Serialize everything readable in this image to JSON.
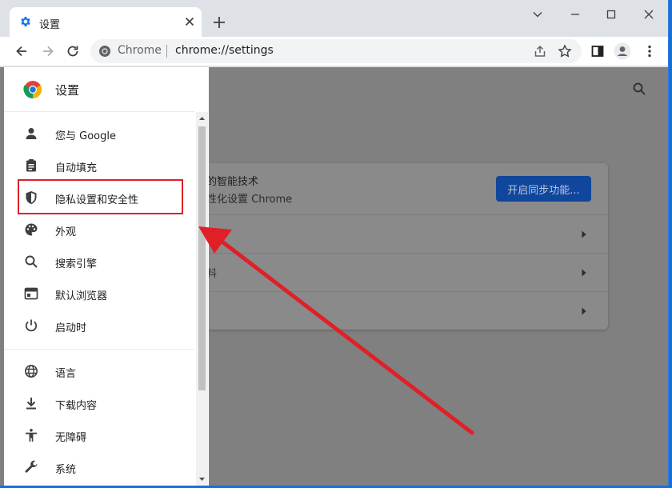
{
  "tab": {
    "title": "设置"
  },
  "omnibox": {
    "site_label": "Chrome",
    "url": "chrome://settings"
  },
  "sidebar": {
    "title": "设置",
    "items": [
      {
        "label": "您与 Google",
        "icon": "person-icon"
      },
      {
        "label": "自动填充",
        "icon": "clipboard-icon"
      },
      {
        "label": "隐私设置和安全性",
        "icon": "shield-icon"
      },
      {
        "label": "外观",
        "icon": "palette-icon"
      },
      {
        "label": "搜索引擎",
        "icon": "search-icon"
      },
      {
        "label": "默认浏览器",
        "icon": "browser-window-icon"
      },
      {
        "label": "启动时",
        "icon": "power-icon"
      },
      {
        "label": "语言",
        "icon": "globe-icon"
      },
      {
        "label": "下载内容",
        "icon": "download-icon"
      },
      {
        "label": "无障碍",
        "icon": "accessibility-icon"
      },
      {
        "label": "系统",
        "icon": "wrench-icon"
      }
    ]
  },
  "card": {
    "sync_title": "的智能技术",
    "sync_subtitle": "性化设置 Chrome",
    "sync_button": "开启同步功能...",
    "row2_label": "料"
  },
  "colors": {
    "accent": "#1a73e8",
    "highlight": "#e02027",
    "overlay": "#808080"
  }
}
